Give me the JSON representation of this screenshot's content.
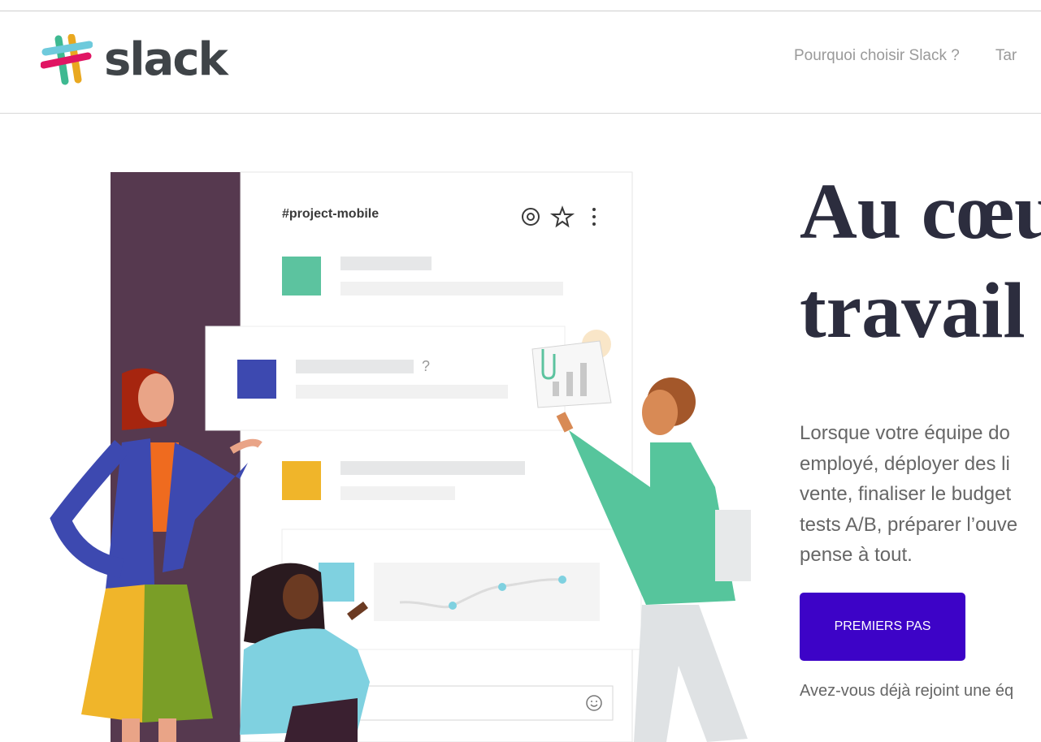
{
  "header": {
    "logo_text": "slack",
    "nav": [
      "Pourquoi choisir Slack ?",
      "Tar"
    ]
  },
  "hero": {
    "title_line1": "Au cœu",
    "title_line2": "travail",
    "description": "Lorsque votre équipe do\nemployé, déployer des li\nvente, finaliser le budget\ntests A/B, préparer l’ouve\npense à tout.",
    "cta_label": "PREMIERS PAS",
    "joined_text": "Avez-vous déjà rejoint une éq"
  },
  "illustration": {
    "channel_name": "#project-mobile",
    "question_mark": "?",
    "icons": [
      "at-icon",
      "star-icon",
      "more-icon",
      "emoji-icon",
      "paperclip-icon"
    ],
    "colors": {
      "sidebar": "#56394f",
      "green_block": "#5cc39f",
      "blue_block": "#3d49b0",
      "yellow_block": "#f0b52a",
      "cta": "#3d03c7",
      "title": "#2c2d3e"
    }
  }
}
